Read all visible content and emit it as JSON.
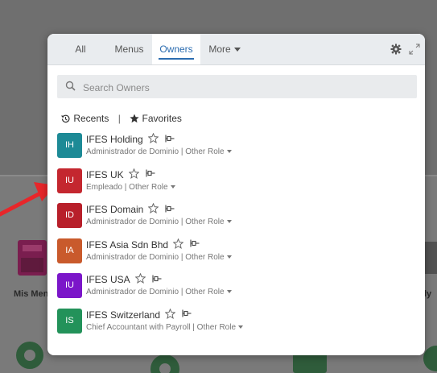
{
  "tabs": [
    {
      "label": "All"
    },
    {
      "label": "Menus"
    },
    {
      "label": "Owners"
    },
    {
      "label": "More"
    }
  ],
  "active_tab": "Owners",
  "search": {
    "placeholder": "Search Owners",
    "value": ""
  },
  "filters": {
    "recents": "Recents",
    "separator": "|",
    "favorites": "Favorites"
  },
  "owners": [
    {
      "initials": "IH",
      "name": "IFES Holding",
      "role": "Administrador de Dominio | Other Role",
      "color": "#1d8a96"
    },
    {
      "initials": "IU",
      "name": "IFES UK",
      "role": "Empleado | Other Role",
      "color": "#c4272f"
    },
    {
      "initials": "ID",
      "name": "IFES Domain",
      "role": "Administrador de Dominio | Other Role",
      "color": "#b81f2a"
    },
    {
      "initials": "IA",
      "name": "IFES Asia Sdn Bhd",
      "role": "Administrador de Dominio | Other Role",
      "color": "#c95a2c"
    },
    {
      "initials": "IU",
      "name": "IFES USA",
      "role": "Administrador de Dominio | Other Role",
      "color": "#7b16c9"
    },
    {
      "initials": "IS",
      "name": "IFES Switzerland",
      "role": "Chief Accountant with Payroll | Other Role",
      "color": "#23925a"
    }
  ],
  "background": {
    "left_label": "Mis Men",
    "right_label": "ly"
  },
  "icons": {
    "settings": "gear-icon",
    "expand": "expand-icon",
    "search": "search-icon",
    "recents": "history-icon",
    "favorites": "star-filled-icon",
    "favorite_toggle": "star-outline-icon",
    "pin": "pin-icon"
  },
  "annotation_color": "#e8262a"
}
